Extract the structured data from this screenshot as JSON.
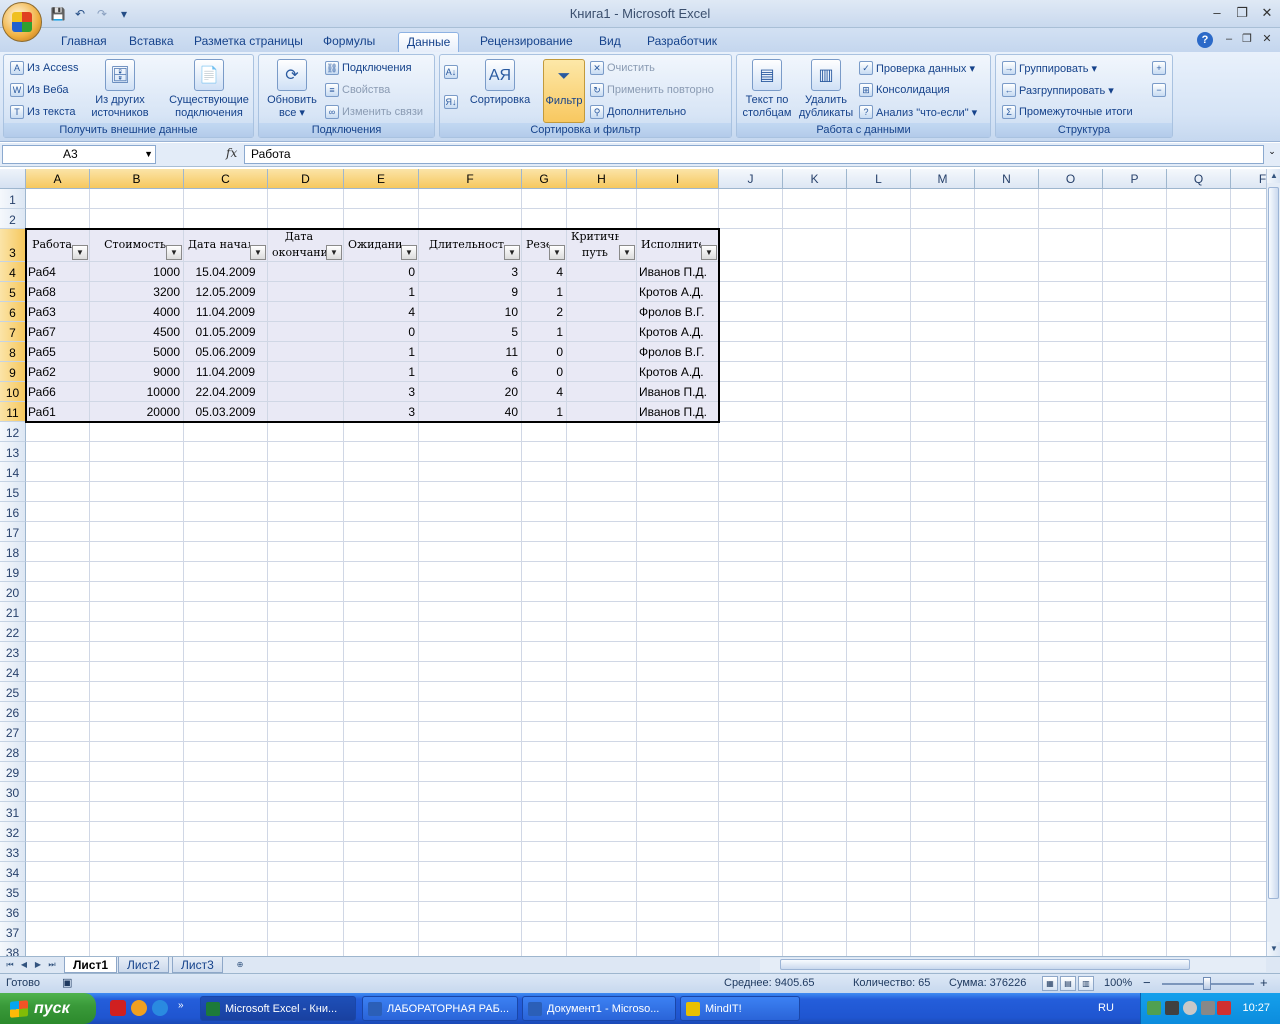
{
  "window": {
    "title": "Книга1 - Microsoft Excel",
    "minimize": "–",
    "restore": "❐",
    "close": "✕"
  },
  "qat": {
    "save_icon": "💾",
    "undo_icon": "↶",
    "redo_icon": "↷",
    "menu_icon": "▾"
  },
  "tabs": [
    "Главная",
    "Вставка",
    "Разметка страницы",
    "Формулы",
    "Данные",
    "Рецензирование",
    "Вид",
    "Разработчик"
  ],
  "active_tab": "Данные",
  "ribbon": {
    "groups": {
      "external": "Получить внешние данные",
      "connections": "Подключения",
      "sortfilter": "Сортировка и фильтр",
      "datatools": "Работа с данными",
      "outline": "Структура"
    },
    "external": {
      "from_access": "Из Access",
      "from_web": "Из Веба",
      "from_text": "Из текста",
      "other_sources_1": "Из других",
      "other_sources_2": "источников ▾",
      "existing_1": "Существующие",
      "existing_2": "подключения"
    },
    "connections": {
      "refresh_1": "Обновить",
      "refresh_2": "все ▾",
      "connections": "Подключения",
      "properties": "Свойства",
      "edit_links": "Изменить связи"
    },
    "sortfilter": {
      "sort": "Сортировка",
      "filter": "Фильтр",
      "clear": "Очистить",
      "reapply": "Применить повторно",
      "advanced": "Дополнительно"
    },
    "datatools": {
      "text_to_cols_1": "Текст по",
      "text_to_cols_2": "столбцам",
      "remove_dup_1": "Удалить",
      "remove_dup_2": "дубликаты",
      "validation": "Проверка данных ▾",
      "consolidate": "Консолидация",
      "whatif": "Анализ \"что-если\" ▾"
    },
    "outline": {
      "group": "Группировать ▾",
      "ungroup": "Разгруппировать ▾",
      "subtotal": "Промежуточные итоги"
    }
  },
  "formula_bar": {
    "name_box": "A3",
    "fx": "fx",
    "formula": "Работа"
  },
  "columns": [
    "A",
    "B",
    "C",
    "D",
    "E",
    "F",
    "G",
    "H",
    "I",
    "J",
    "K",
    "L",
    "M",
    "N",
    "O",
    "P",
    "Q",
    "F"
  ],
  "rows": [
    "1",
    "2",
    "3",
    "4",
    "5",
    "6",
    "7",
    "8",
    "9",
    "10",
    "11",
    "12",
    "13",
    "14",
    "15",
    "16",
    "17",
    "18",
    "19",
    "20",
    "21",
    "22",
    "23",
    "24",
    "25",
    "26",
    "27",
    "28",
    "29",
    "30",
    "31",
    "32",
    "33",
    "34",
    "35",
    "36",
    "37",
    "38"
  ],
  "table": {
    "headers": [
      {
        "text": "Работа"
      },
      {
        "text": "Стоимость"
      },
      {
        "text": "Дата начал"
      },
      {
        "text": "Дата\nокончани"
      },
      {
        "text": "Ожидани"
      },
      {
        "text": "Длительност"
      },
      {
        "text": "Резе"
      },
      {
        "text": "Критичный\nпуть"
      },
      {
        "text": "Исполните"
      }
    ],
    "rows": [
      [
        "Раб4",
        "1000",
        "15.04.2009",
        "",
        "0",
        "3",
        "4",
        "",
        "Иванов П.Д."
      ],
      [
        "Раб8",
        "3200",
        "12.05.2009",
        "",
        "1",
        "9",
        "1",
        "",
        "Кротов А.Д."
      ],
      [
        "Раб3",
        "4000",
        "11.04.2009",
        "",
        "4",
        "10",
        "2",
        "",
        "Фролов В.Г."
      ],
      [
        "Раб7",
        "4500",
        "01.05.2009",
        "",
        "0",
        "5",
        "1",
        "",
        "Кротов А.Д."
      ],
      [
        "Раб5",
        "5000",
        "05.06.2009",
        "",
        "1",
        "11",
        "0",
        "",
        "Фролов В.Г."
      ],
      [
        "Раб2",
        "9000",
        "11.04.2009",
        "",
        "1",
        "6",
        "0",
        "",
        "Кротов А.Д."
      ],
      [
        "Раб6",
        "10000",
        "22.04.2009",
        "",
        "3",
        "20",
        "4",
        "",
        "Иванов П.Д."
      ],
      [
        "Раб1",
        "20000",
        "05.03.2009",
        "",
        "3",
        "40",
        "1",
        "",
        "Иванов П.Д."
      ]
    ]
  },
  "sheets": [
    "Лист1",
    "Лист2",
    "Лист3"
  ],
  "active_sheet": "Лист1",
  "status": {
    "ready": "Готово",
    "average": "Среднее: 9405.65",
    "count": "Количество: 65",
    "sum": "Сумма: 376226",
    "zoom": "100%",
    "zoom_minus": "−",
    "zoom_plus": "+"
  },
  "taskbar": {
    "start": "пуск",
    "tasks": [
      {
        "label": "Microsoft Excel - Кни...",
        "color": "#1d7a3a"
      },
      {
        "label": "ЛАБОРАТОРНАЯ РАБ...",
        "color": "#2b5fb8"
      },
      {
        "label": "Документ1 - Microso...",
        "color": "#2b5fb8"
      },
      {
        "label": "MindIT!",
        "color": "#e8c000"
      }
    ],
    "language": "RU",
    "clock": "10:27"
  }
}
